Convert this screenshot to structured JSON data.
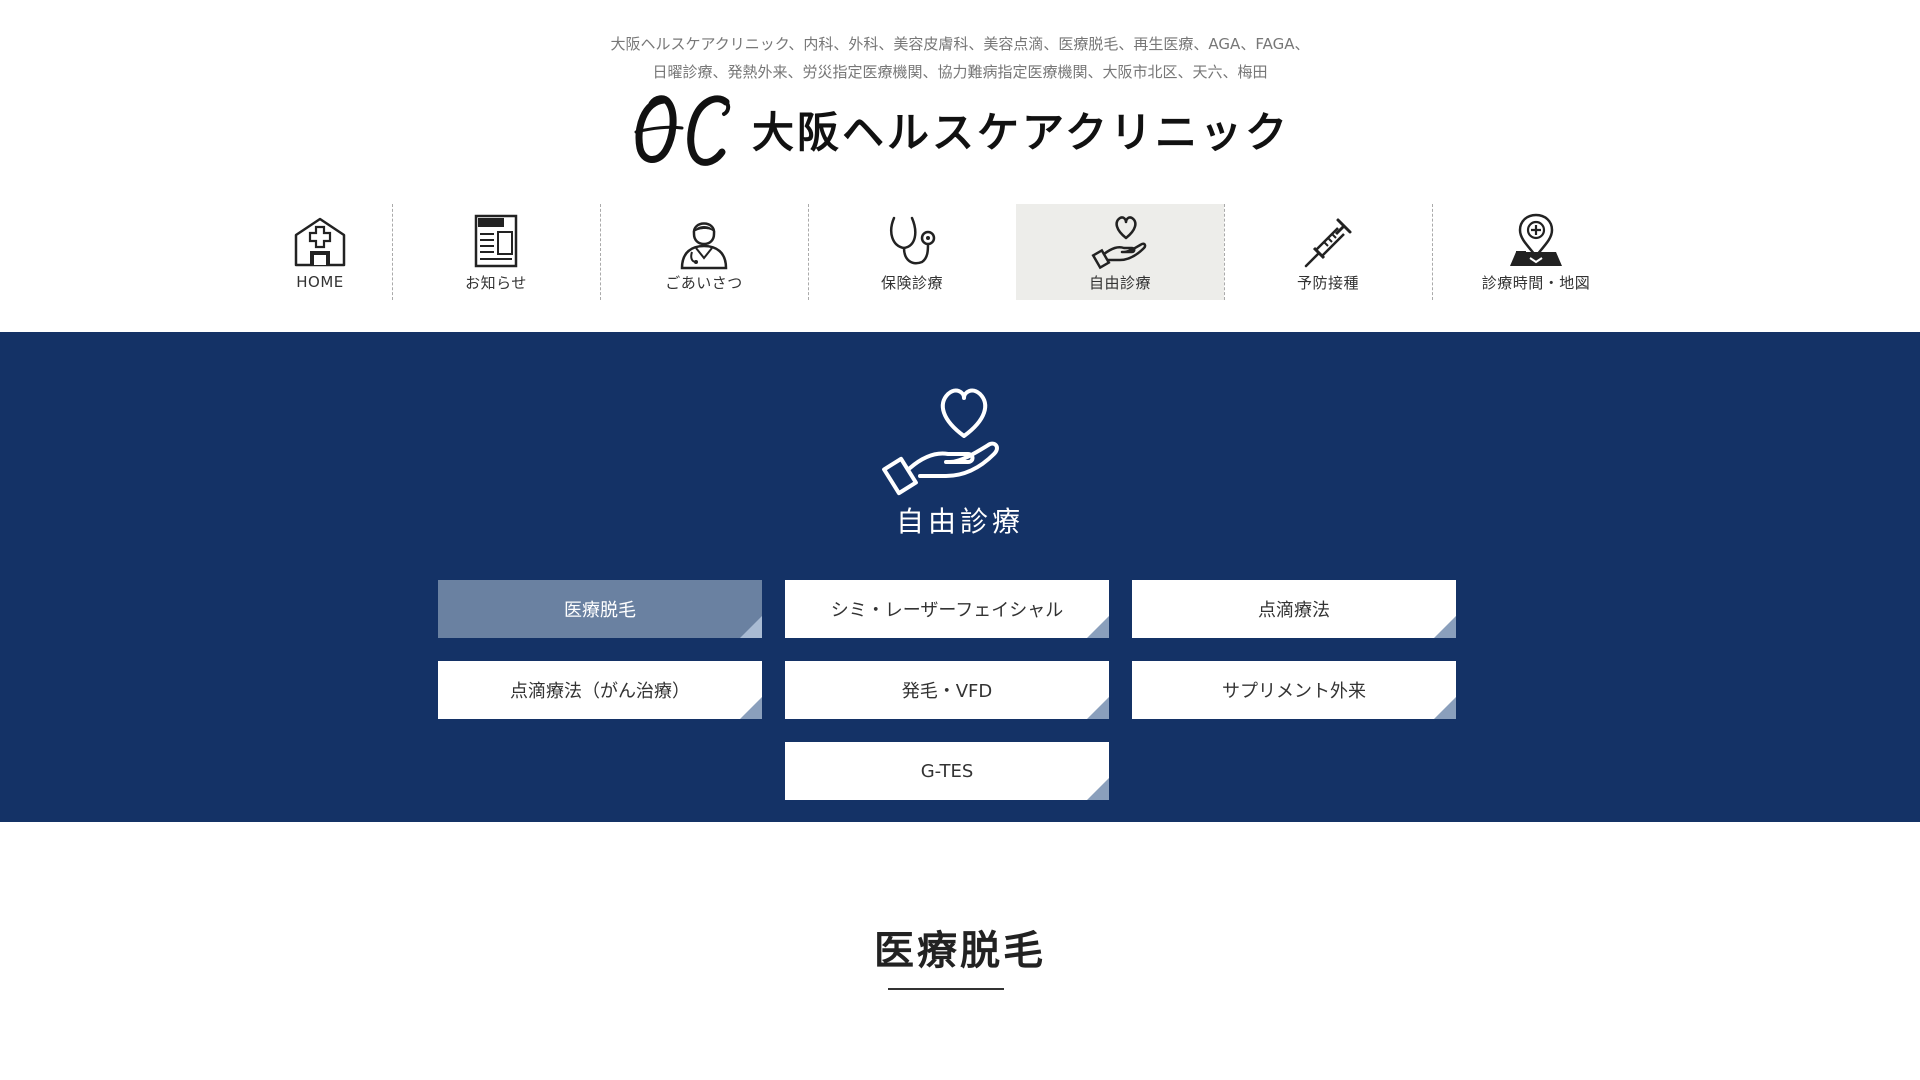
{
  "header": {
    "tagline_line1": "大阪ヘルスケアクリニック、内科、外科、美容皮膚科、美容点滴、医療脱毛、再生医療、AGA、FAGA、",
    "tagline_line2": "日曜診療、発熱外来、労災指定医療機関、協力難病指定医療機関、大阪市北区、天六、梅田",
    "logo_text": "大阪ヘルスケアクリニック",
    "logo_mark": "0C"
  },
  "nav": {
    "items": [
      {
        "label": "HOME",
        "icon": "hospital-icon"
      },
      {
        "label": "お知らせ",
        "icon": "newspaper-icon"
      },
      {
        "label": "ごあいさつ",
        "icon": "doctor-icon"
      },
      {
        "label": "保険診療",
        "icon": "stethoscope-icon"
      },
      {
        "label": "自由診療",
        "icon": "heart-hand-icon"
      },
      {
        "label": "予防接種",
        "icon": "syringe-icon"
      },
      {
        "label": "診療時間・地図",
        "icon": "map-pin-icon"
      }
    ],
    "active_index": 4
  },
  "hero": {
    "title": "自由診療",
    "icon": "heart-hand-icon",
    "background_color": "#143266",
    "buttons": [
      {
        "label": "医療脱毛",
        "active": true
      },
      {
        "label": "シミ・レーザーフェイシャル",
        "active": false
      },
      {
        "label": "点滴療法",
        "active": false
      },
      {
        "label": "点滴療法（がん治療）",
        "active": false
      },
      {
        "label": "発毛・VFD",
        "active": false
      },
      {
        "label": "サプリメント外来",
        "active": false
      },
      {
        "label": "G-TES",
        "active": false
      }
    ]
  },
  "section": {
    "title": "医療脱毛"
  },
  "colors": {
    "navy": "#143266",
    "active_button": "#6a81a1",
    "active_nav_bg": "#ededea"
  }
}
